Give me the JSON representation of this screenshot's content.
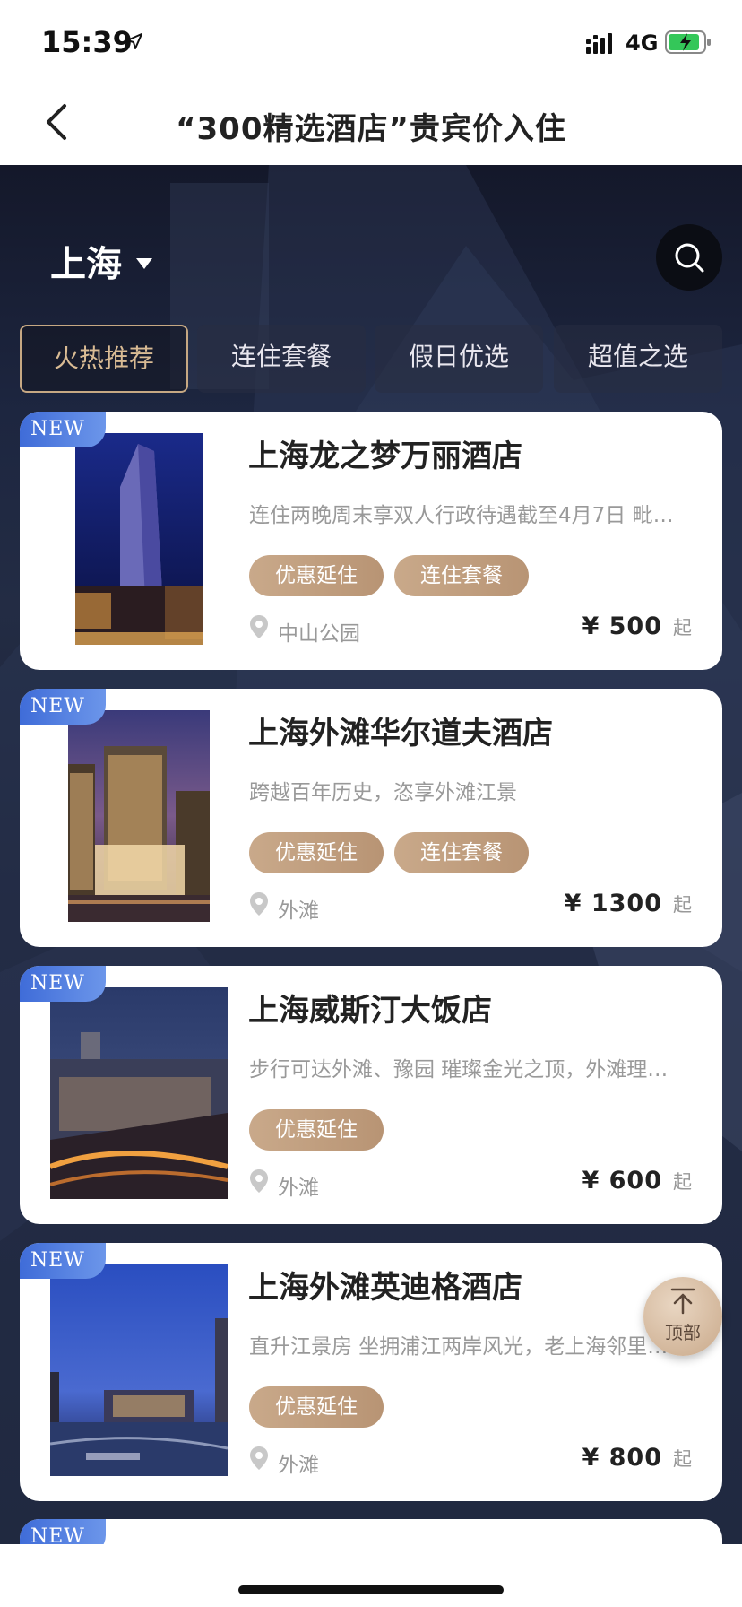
{
  "status_bar": {
    "time": "15:39",
    "network": "4G"
  },
  "nav": {
    "title": "“300精选酒店”贵宾价入住"
  },
  "city": "上海",
  "tabs": [
    {
      "label": "火热推荐",
      "active": true
    },
    {
      "label": "连住套餐",
      "active": false
    },
    {
      "label": "假日优选",
      "active": false
    },
    {
      "label": "超值之选",
      "active": false
    }
  ],
  "hotels": [
    {
      "badge": "NEW",
      "name": "上海龙之梦万丽酒店",
      "desc": "连住两晚周末享双人行政待遇截至4月7日 毗邻…",
      "tags": [
        "优惠延住",
        "连住套餐"
      ],
      "location": "中山公园",
      "price": "¥ 500",
      "price_suffix": "起"
    },
    {
      "badge": "NEW",
      "name": "上海外滩华尔道夫酒店",
      "desc": "跨越百年历史，恣享外滩江景",
      "tags": [
        "优惠延住",
        "连住套餐"
      ],
      "location": "外滩",
      "price": "¥ 1300",
      "price_suffix": "起"
    },
    {
      "badge": "NEW",
      "name": "上海威斯汀大饭店",
      "desc": "步行可达外滩、豫园 璀璨金光之顶，外滩理…",
      "tags": [
        "优惠延住"
      ],
      "location": "外滩",
      "price": "¥ 600",
      "price_suffix": "起"
    },
    {
      "badge": "NEW",
      "name": "上海外滩英迪格酒店",
      "desc": "直升江景房 坐拥浦江两岸风光，老上海邻里…",
      "tags": [
        "优惠延住"
      ],
      "location": "外滩",
      "price": "¥ 800",
      "price_suffix": "起"
    }
  ],
  "peek": {
    "badge": "NEW"
  },
  "back_to_top": {
    "label": "顶部"
  },
  "colors": {
    "accent_gold": "#c6a883",
    "tag_bg": "#c0a080",
    "badge_blue": "#4a78dd",
    "hero_bg": "#1d2640"
  },
  "icons": [
    "location-arrow-icon",
    "signal-icon",
    "battery-charging-icon",
    "back-chevron-icon",
    "search-icon",
    "caret-down-icon",
    "location-pin-icon",
    "arrow-up-icon"
  ]
}
